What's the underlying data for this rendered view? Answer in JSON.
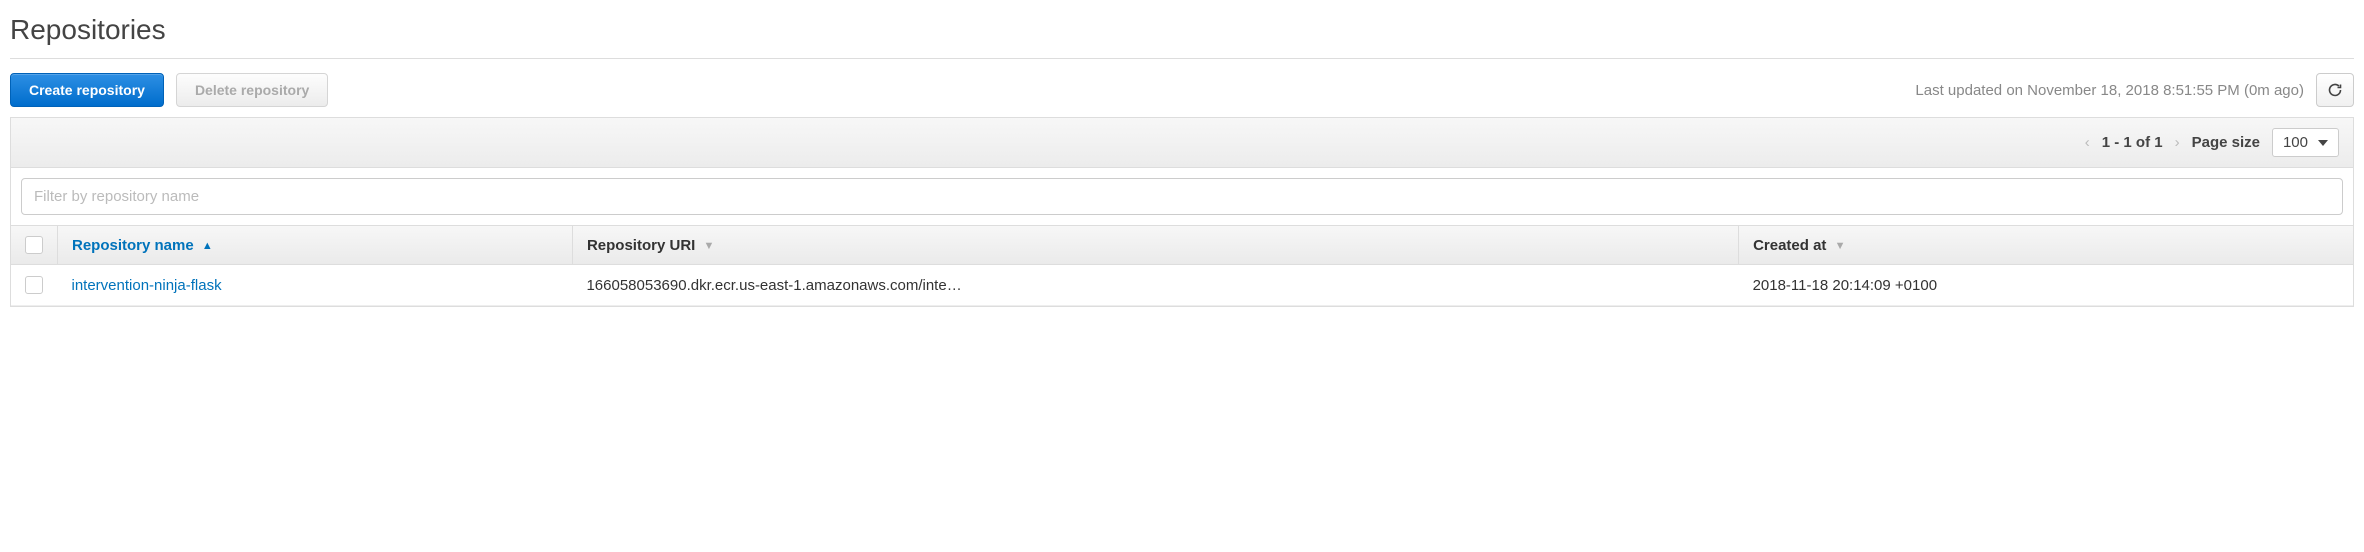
{
  "header": {
    "title": "Repositories"
  },
  "toolbar": {
    "create_label": "Create repository",
    "delete_label": "Delete repository",
    "last_updated": "Last updated on November 18, 2018 8:51:55 PM (0m ago)"
  },
  "pagination": {
    "range_text": "1 - 1 of 1",
    "page_size_label": "Page size",
    "page_size_value": "100"
  },
  "filter": {
    "placeholder": "Filter by repository name"
  },
  "columns": {
    "name": "Repository name",
    "uri": "Repository URI",
    "created": "Created at"
  },
  "rows": [
    {
      "name": "intervention-ninja-flask",
      "uri": "166058053690.dkr.ecr.us-east-1.amazonaws.com/inte…",
      "created": "2018-11-18 20:14:09 +0100"
    }
  ]
}
